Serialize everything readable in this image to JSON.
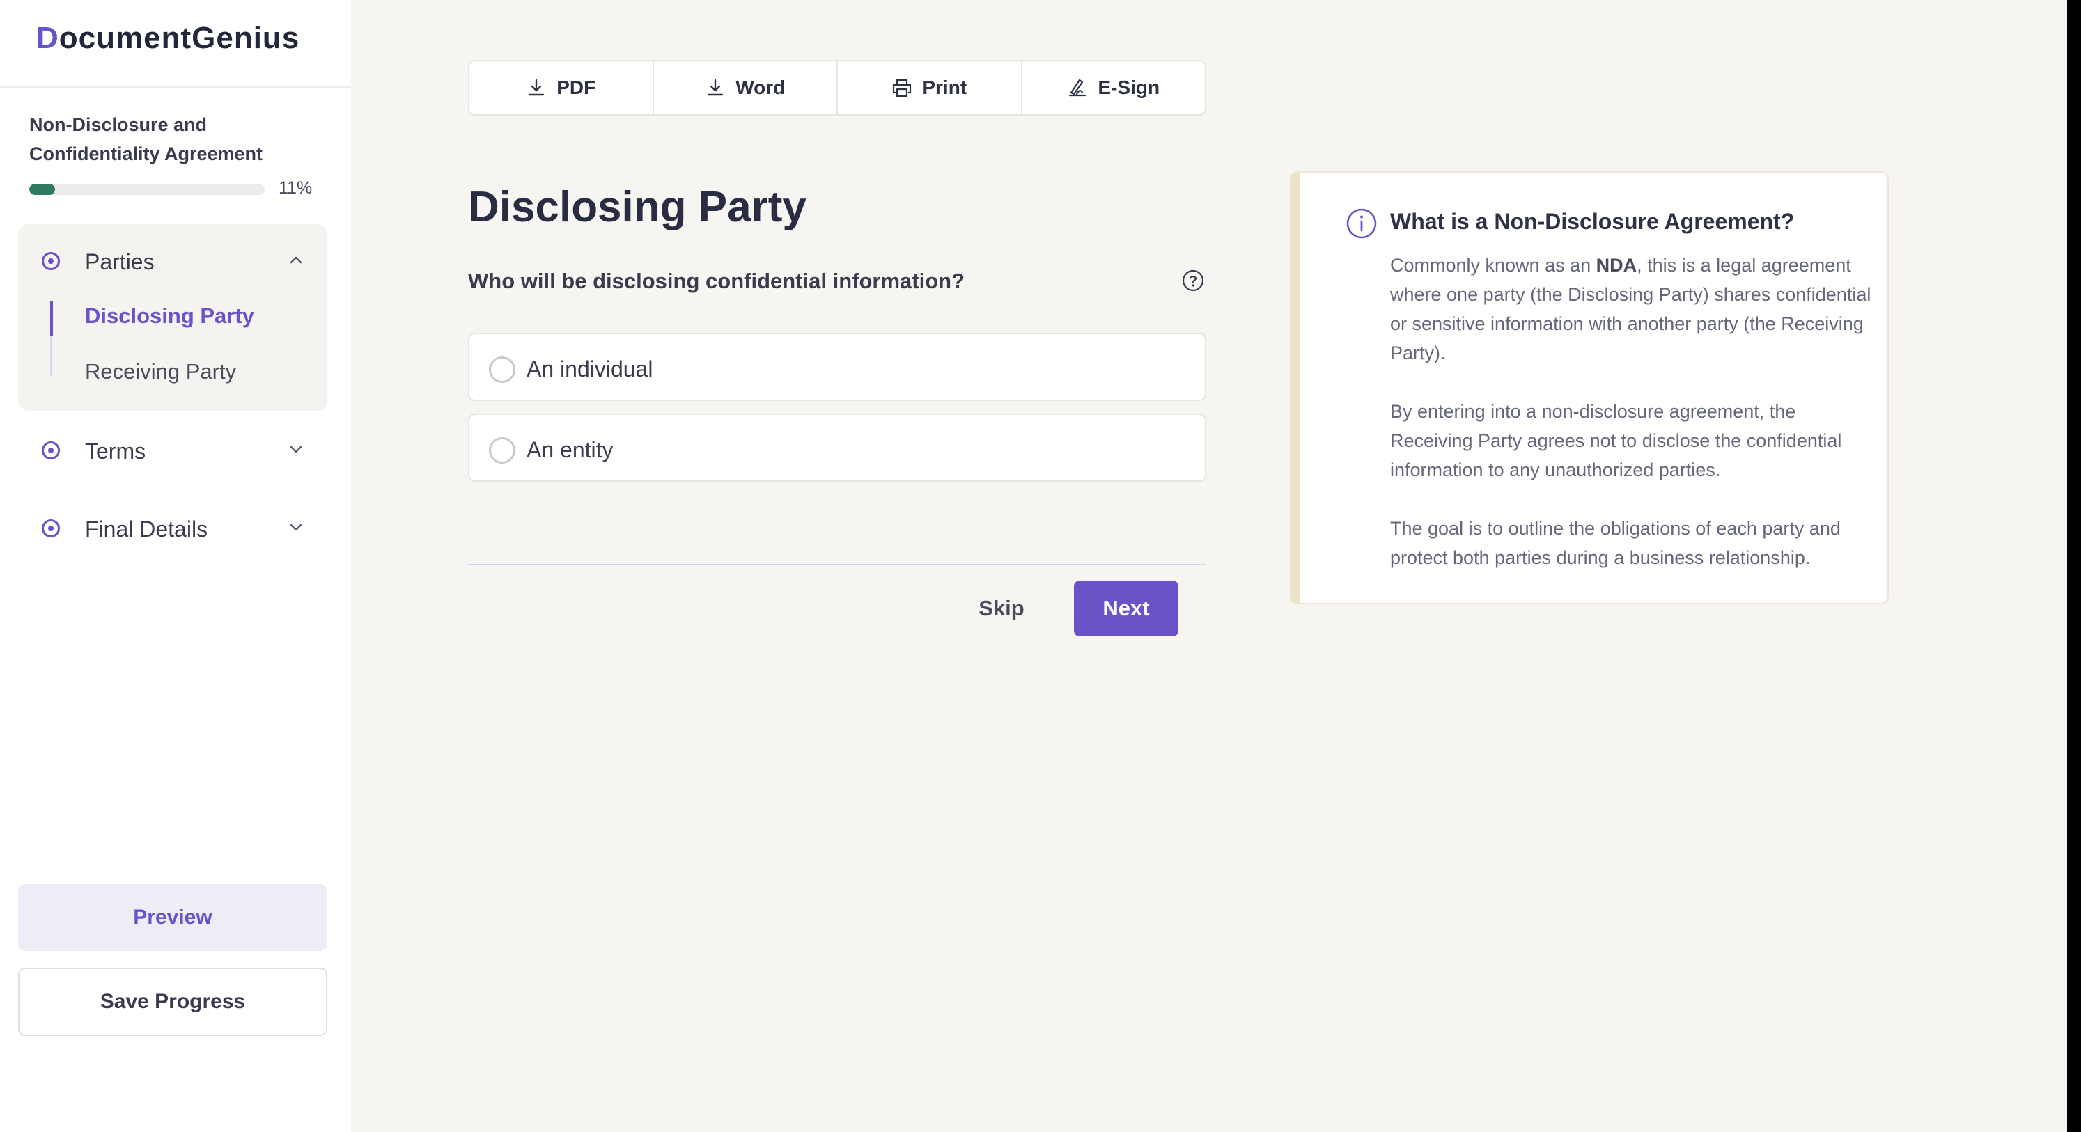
{
  "app": {
    "logo_initial": "D",
    "logo_rest": "ocumentGenius"
  },
  "document": {
    "title": "Non-Disclosure and Confidentiality Agreement",
    "progress_label": "11%",
    "progress_fraction": 0.11
  },
  "sidebar": {
    "sections": [
      {
        "label": "Parties",
        "expanded": true
      },
      {
        "label": "Terms",
        "expanded": false
      },
      {
        "label": "Final Details",
        "expanded": false
      }
    ],
    "parties_items": [
      {
        "label": "Disclosing Party",
        "active": true
      },
      {
        "label": "Receiving Party",
        "active": false
      }
    ],
    "preview_label": "Preview",
    "save_label": "Save Progress"
  },
  "toolbar": {
    "pdf": "PDF",
    "word": "Word",
    "print": "Print",
    "esign": "E-Sign"
  },
  "form": {
    "title": "Disclosing Party",
    "question": "Who will be disclosing confidential information?",
    "options": [
      "An individual",
      "An entity"
    ],
    "skip_label": "Skip",
    "next_label": "Next"
  },
  "info": {
    "title": "What is a Non-Disclosure Agreement?",
    "p1_pre": "Commonly known as an ",
    "p1_bold": "NDA",
    "p1_post": ", this is a legal agreement where one party (the Disclosing Party) shares confidential or sensitive information with another party (the Receiving Party).",
    "p2": "By entering into a non-disclosure agreement, the Receiving Party agrees not to disclose the confidential information to any unauthorized parties.",
    "p3": "The goal is to outline the obligations of each party and protect both parties during a business relationship."
  },
  "colors": {
    "accent": "#6a52c8",
    "progress": "#2f7a63",
    "background": "#f6f5f2"
  }
}
